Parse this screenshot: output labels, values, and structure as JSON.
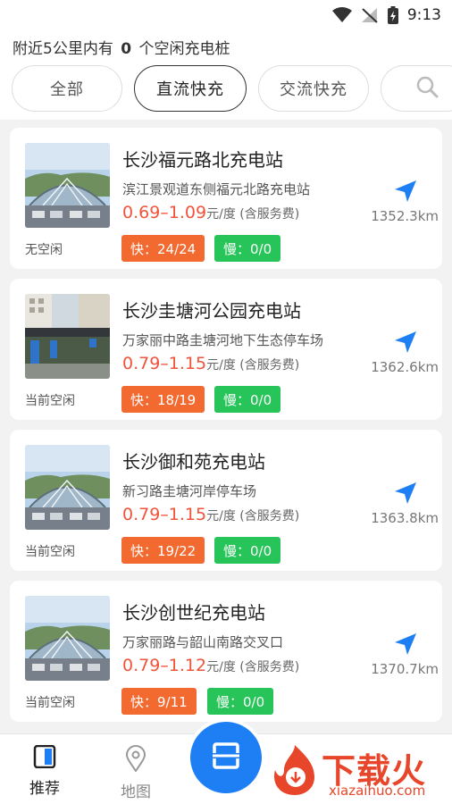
{
  "status_bar": {
    "time": "9:13"
  },
  "summary": {
    "prefix": "附近5公里内有",
    "count": "0",
    "suffix": "个空闲充电桩"
  },
  "filters": [
    {
      "label": "全部"
    },
    {
      "label": "直流快充",
      "active": true
    },
    {
      "label": "交流快充"
    }
  ],
  "price_unit": "元/度 (含服务费)",
  "stations": [
    {
      "name": "长沙福元路北充电站",
      "address": "滨江景观道东侧福元北路充电站",
      "price": "0.69–1.09",
      "status": "无空闲",
      "fast": "快：24/24",
      "slow": "慢：0/0",
      "distance": "1352.3km"
    },
    {
      "name": "长沙圭塘河公园充电站",
      "address": "万家丽中路圭塘河地下生态停车场",
      "price": "0.79–1.15",
      "status": "当前空闲",
      "fast": "快：18/19",
      "slow": "慢：0/0",
      "distance": "1362.6km"
    },
    {
      "name": "长沙御和苑充电站",
      "address": "新习路圭塘河岸停车场",
      "price": "0.79–1.15",
      "status": "当前空闲",
      "fast": "快：19/22",
      "slow": "慢：0/0",
      "distance": "1363.8km"
    },
    {
      "name": "长沙创世纪充电站",
      "address": "万家丽路与韶山南路交叉口",
      "price": "0.79–1.12",
      "status": "当前空闲",
      "fast": "快：9/11",
      "slow": "慢：0/0",
      "distance": "1370.7km"
    }
  ],
  "bottom_nav": {
    "home": "推荐",
    "map": "地图"
  },
  "watermark": {
    "title": "下载火",
    "sub": "xiazaihuo.com"
  },
  "colors": {
    "accent": "#1e7ff5",
    "price": "#f2533b",
    "fast": "#f26a2f",
    "slow": "#27c45a",
    "watermark": "#e8462a"
  }
}
